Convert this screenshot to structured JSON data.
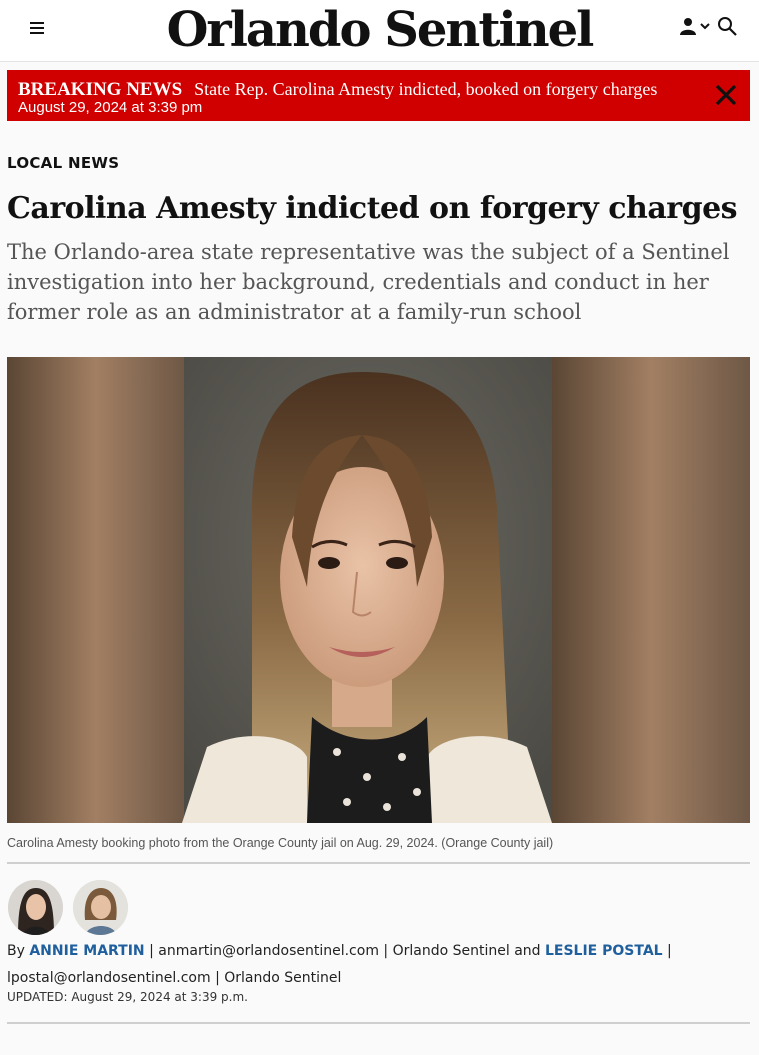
{
  "header": {
    "masthead": "Orlando Sentinel",
    "menu_icon": "hamburger-menu-icon",
    "account_icon": "user-icon",
    "dropdown_icon": "chevron-down-icon",
    "search_icon": "search-icon"
  },
  "breaking": {
    "label": "BREAKING NEWS",
    "text": "State Rep. Carolina Amesty indicted, booked on forgery charges",
    "date": "August 29, 2024 at 3:39 pm",
    "close_icon": "close-icon",
    "background": "#d00000"
  },
  "article": {
    "section": "LOCAL NEWS",
    "headline": "Carolina Amesty indicted on forgery charges",
    "dek": "The Orlando-area state representative was the subject of a Sentinel investigation into her background, credentials and conduct in her former role as an administrator at a family-run school",
    "caption": "Carolina Amesty booking photo from the Orange County jail on Aug. 29, 2024. (Orange County jail)",
    "byline": {
      "by": "By",
      "author1": "ANNIE MARTIN",
      "email1": "anmartin@orlandosentinel.com",
      "org1": "Orlando Sentinel and",
      "author2": "LESLIE POSTAL",
      "email2": "lpostal@orlandosentinel.com",
      "org2": "Orlando Sentinel",
      "sep": "|"
    },
    "updated": "UPDATED: August 29, 2024 at 3:39 p.m.",
    "link_color": "#1f5f9e"
  }
}
